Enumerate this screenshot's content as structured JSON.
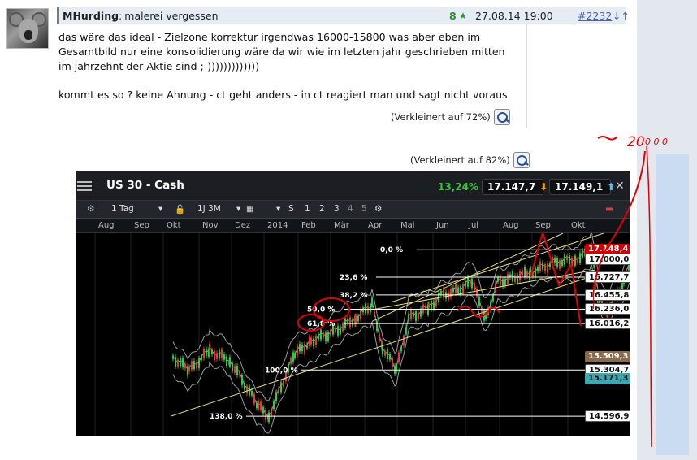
{
  "post": {
    "author": "MHurding",
    "subject": "malerei vergessen",
    "votes": "8",
    "date": "27.08.14 19:00",
    "post_number": "#2232",
    "arrows": "↓↑",
    "paragraph1_line1": "das wäre das ideal - Zielzone korrektur irgendwas 16000-15800 was aber eben im",
    "paragraph1_line2": "Gesamtbild nur eine konsolidierung wäre da wir wie im letzten jahr geschrieben mitten",
    "paragraph1_line3": "im jahrzehnt der Aktie sind ;-)))))))))))))",
    "paragraph2": "kommt es so ? keine Ahnung - ct geht anders - in ct reagiert man und sagt nicht voraus",
    "reduced1": "(Verkleinert auf 72%)",
    "reduced2": "(Verkleinert auf 82%)"
  },
  "chart_window": {
    "title": "US 30 - Cash",
    "change_pct": "13,24%",
    "bid": "17.147,7",
    "ask": "17.149,1",
    "close": "✕",
    "toolbar": {
      "interval": "1 Tag",
      "range": "1J 3M",
      "s": "S",
      "b1": "1",
      "b2": "2",
      "b3": "3",
      "b4": "4",
      "b5": "5"
    },
    "months": [
      "Aug",
      "Sep",
      "Okt",
      "Nov",
      "Dez",
      "2014",
      "Feb",
      "Mär",
      "Apr",
      "Mai",
      "Jun",
      "Jul",
      "Aug",
      "Sep",
      "Okt"
    ]
  },
  "chart_data": {
    "type": "line",
    "title": "US 30 - Cash",
    "fib_levels": [
      {
        "label": "0,0 %",
        "price": "17.148,4"
      },
      {
        "label": "23,6 %",
        "price": "16.727,7"
      },
      {
        "label": "38,2 %",
        "price": "16.455,8"
      },
      {
        "label": "50,0 %",
        "price": "16.236,0"
      },
      {
        "label": "61,8 %",
        "price": "16.016,2"
      },
      {
        "label": "100,0 %",
        "price": "15.304,7"
      },
      {
        "label": "138,0 %",
        "price": "14.596,9"
      }
    ],
    "price_tags": [
      "17.148,4",
      "17.000,0",
      "16.727,7",
      "16.455,8",
      "16.236,0",
      "16.016,2",
      "15.509,3",
      "15.304,7",
      "15.171,3",
      "14.596,9"
    ],
    "current_price": "17.148,4",
    "annotation": "~ 20 000",
    "colors": {
      "background": "#000000",
      "up": "#2ecc40",
      "down": "#e53935",
      "fib": "#ffffff",
      "channel": "#e6e07a",
      "annotation": "#e00000"
    }
  }
}
